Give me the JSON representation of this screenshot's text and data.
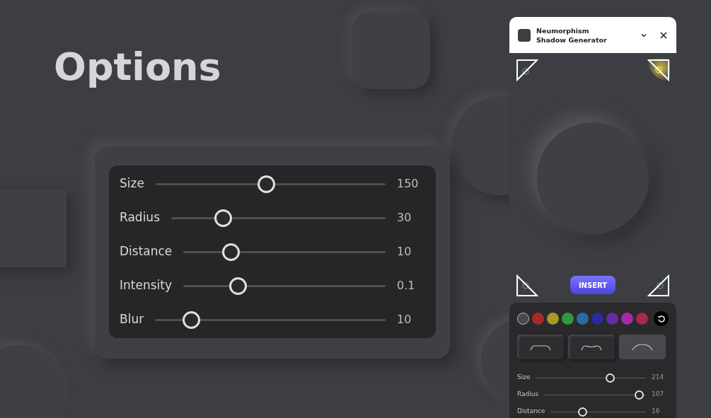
{
  "title": "Options",
  "options_panel": {
    "sliders": [
      {
        "label": "Size",
        "level": 0.48,
        "reading": "150"
      },
      {
        "label": "Radius",
        "level": 0.22,
        "reading": "30"
      },
      {
        "label": "Distance",
        "level": 0.21,
        "reading": "10"
      },
      {
        "label": "Intensity",
        "level": 0.25,
        "reading": "0.1"
      },
      {
        "label": "Blur",
        "level": 0.13,
        "reading": "10"
      }
    ]
  },
  "plugin": {
    "window_title": "Neumorphism Shadow Generator",
    "light_corners": [
      {
        "selected": false
      },
      {
        "selected": true
      },
      {
        "selected": false
      },
      {
        "selected": false
      }
    ],
    "insert_button": "INSERT",
    "swatches": [
      {
        "color": "#48494e",
        "selected": true
      },
      {
        "color": "#a62a2a",
        "selected": false
      },
      {
        "color": "#a59a24",
        "selected": false
      },
      {
        "color": "#2e9a3e",
        "selected": false
      },
      {
        "color": "#2a6aa6",
        "selected": false
      },
      {
        "color": "#2a2aa0",
        "selected": false
      },
      {
        "color": "#6a2aa6",
        "selected": false
      },
      {
        "color": "#a62aa6",
        "selected": false
      },
      {
        "color": "#a62a4a",
        "selected": false
      }
    ],
    "shapes": [
      {
        "kind": "flat",
        "selected": false
      },
      {
        "kind": "concave",
        "selected": false
      },
      {
        "kind": "convex",
        "selected": true
      }
    ],
    "sliders": [
      {
        "label": "Size",
        "level": 0.69,
        "reading": "214"
      },
      {
        "label": "Radius",
        "level": 0.98,
        "reading": "107"
      },
      {
        "label": "Distance",
        "level": 0.32,
        "reading": "16"
      }
    ]
  }
}
